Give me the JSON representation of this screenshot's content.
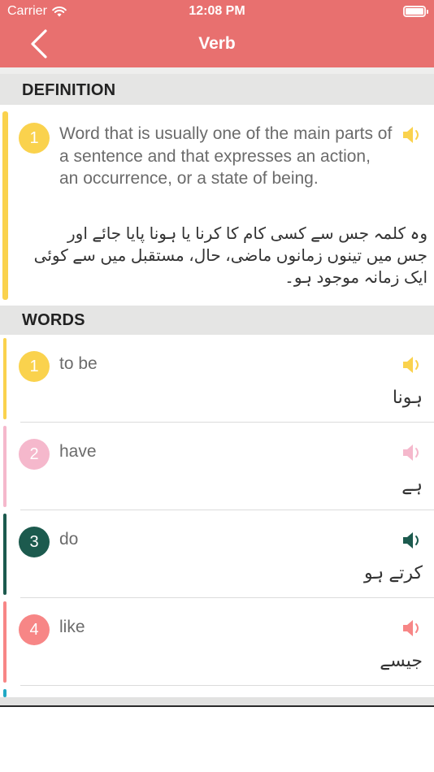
{
  "status": {
    "carrier": "Carrier",
    "time": "12:08 PM"
  },
  "nav": {
    "title": "Verb"
  },
  "sections": {
    "definition": "DEFINITION",
    "words": "WORDS"
  },
  "definition": {
    "number": "1",
    "english": "Word that is usually one of the main parts of a sentence and that expresses an action, an occurrence, or a state of being.",
    "urdu": "وہ کلمہ جس سے کسی کام کا کرنا یا ہونا پایا جائے اور جس میں تینوں زمانوں ماضی، حال، مستقبل میں سے کوئی ایک زمانہ موجود ہو۔",
    "color": "#fad24d"
  },
  "words": [
    {
      "number": "1",
      "english": "to be",
      "urdu": "ہونا",
      "color": "#fad24d"
    },
    {
      "number": "2",
      "english": "have",
      "urdu": "ہے",
      "color": "#f5b8cc"
    },
    {
      "number": "3",
      "english": "do",
      "urdu": "کرتے ہو",
      "color": "#1c5a4e"
    },
    {
      "number": "4",
      "english": "like",
      "urdu": "جیسے",
      "color": "#f78686"
    }
  ],
  "theme": {
    "header": "#e8706f",
    "next_item_accent": "#20a8c4"
  },
  "icons": {
    "back": "chevron-left-icon",
    "speaker": "speaker-icon",
    "wifi": "wifi-icon",
    "battery": "battery-icon"
  }
}
